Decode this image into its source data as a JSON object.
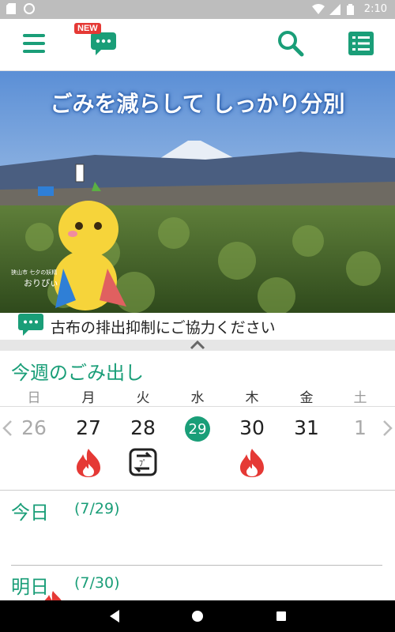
{
  "status_bar": {
    "time": "2:10"
  },
  "app_bar": {
    "new_badge": "NEW"
  },
  "hero": {
    "title": "ごみを減らして しっかり分別",
    "mascot_caption_1": "狭山市 七夕の妖精",
    "mascot_caption_2": "おりぴぃ"
  },
  "notice": {
    "text": "古布の排出抑制にご協力ください"
  },
  "week": {
    "title": "今週のごみ出し",
    "weekdays": [
      "日",
      "月",
      "火",
      "水",
      "木",
      "金",
      "土"
    ],
    "dates": [
      "26",
      "27",
      "28",
      "29",
      "30",
      "31",
      "1"
    ],
    "today_index": 3
  },
  "today_card": {
    "label": "今日",
    "date": "(7/29)"
  },
  "tomorrow_card": {
    "label": "明日",
    "date": "(7/30)"
  },
  "colors": {
    "accent": "#1a9e78",
    "burnable": "#e53935"
  }
}
